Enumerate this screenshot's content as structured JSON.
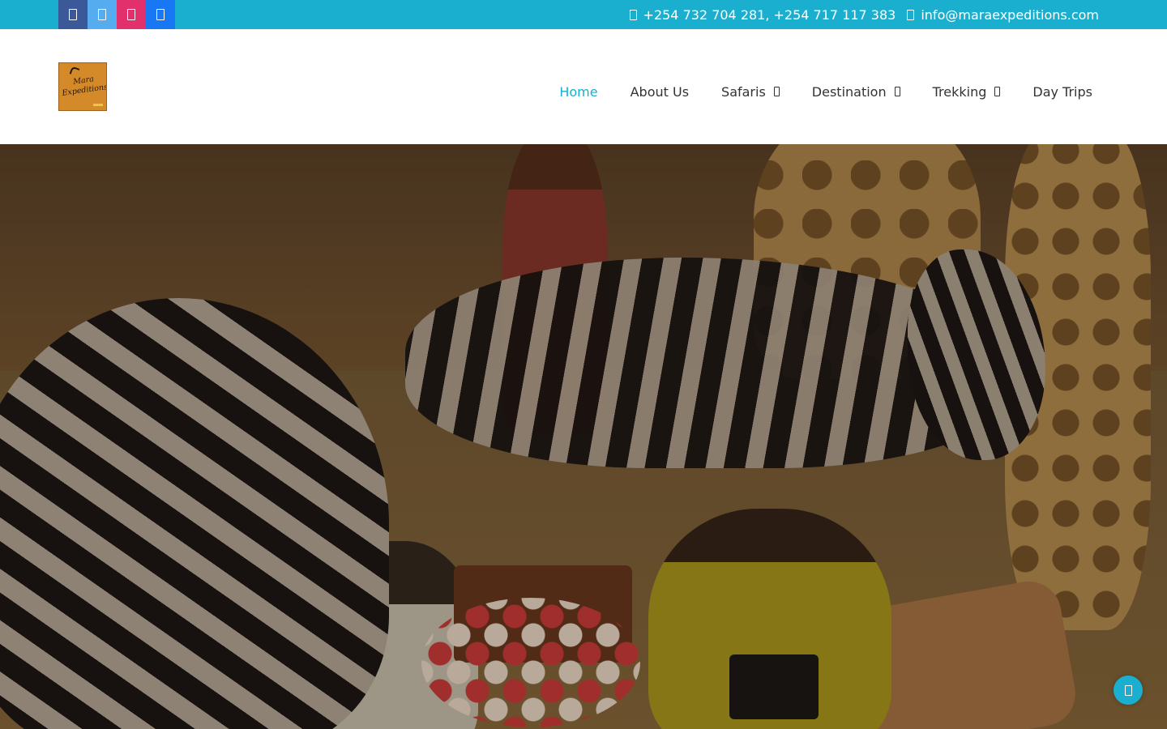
{
  "topbar": {
    "social": [
      {
        "name": "facebook-icon"
      },
      {
        "name": "twitter-icon"
      },
      {
        "name": "instagram-icon"
      },
      {
        "name": "linkedin-icon"
      }
    ],
    "phone": "+254 732 704 281, +254 717 117 383",
    "email": "info@maraexpeditions.com",
    "colors": {
      "bar": "#1aafcf",
      "facebook": "#3b5998",
      "twitter": "#55acee",
      "instagram": "#e1306c",
      "linkedin": "#1877f2"
    }
  },
  "header": {
    "logo_text": "Mara Expeditions",
    "nav": [
      {
        "label": "Home",
        "active": true
      },
      {
        "label": "About Us"
      },
      {
        "label": "Safaris",
        "dropdown": true
      },
      {
        "label": "Destination",
        "dropdown": true
      },
      {
        "label": "Trekking",
        "dropdown": true
      },
      {
        "label": "Day Trips"
      }
    ],
    "colors": {
      "active": "#1aafcf",
      "text": "#333333"
    }
  },
  "hero": {
    "image": "safari picnic with zebras, giraffes, maasai and couple"
  },
  "scroll_top": {
    "icon": "arrow-up-icon"
  }
}
